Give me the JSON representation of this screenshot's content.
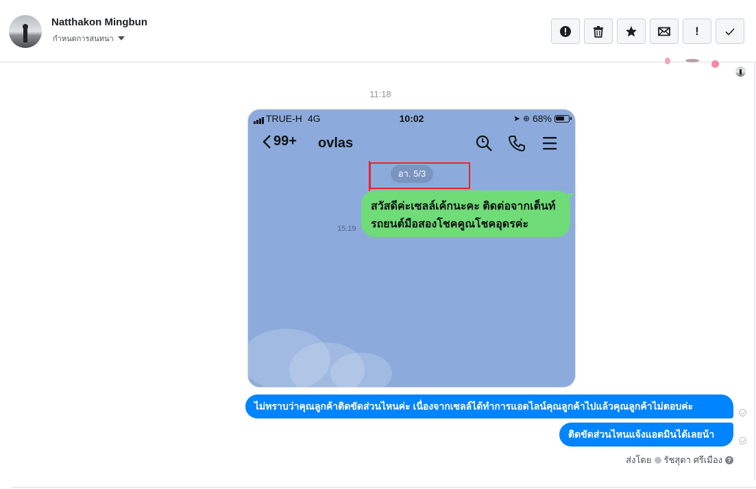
{
  "header": {
    "contact_name": "Natthakon Mingbun",
    "label_dropdown": "กำหนดการสนทนา"
  },
  "toolbar": {
    "buttons": [
      {
        "icon": "alert-circle-icon",
        "name": "mark-spam-button"
      },
      {
        "icon": "trash-icon",
        "name": "delete-button"
      },
      {
        "icon": "star-icon",
        "name": "star-button"
      },
      {
        "icon": "envelope-icon",
        "name": "mark-unread-button"
      },
      {
        "icon": "exclamation-icon",
        "name": "mark-important-button",
        "glyph": "!"
      },
      {
        "icon": "check-icon",
        "name": "mark-done-button"
      }
    ]
  },
  "thread": {
    "timestamp": "11:18",
    "screenshot": {
      "carrier": "TRUE-H",
      "network": "4G",
      "time": "10:02",
      "battery": "68%",
      "back_count": "99+",
      "chat_name": "ovlas",
      "date_pill": "อา. 5/3",
      "bubble_text": "สวัสดีค่ะเซลล์เค้กนะคะ ติดต่อจากเต็นท์รถยนต์มือสองโชคคูณโชคอุดรค่ะ",
      "bubble_time": "15:19"
    },
    "messages": [
      {
        "text": "ไม่ทราบว่าคุณลูกค้าติดขัดส่วนไหนค่ะ เนื่องจากเซลล์ได้ทำการแอดไลน์คุณลูกค้าไปแล้วคุณลูกค้าไม่ตอบค่ะ"
      },
      {
        "text": "ติดขัดส่วนไหนแจ้งแอดมินได้เลยน้า"
      }
    ],
    "sent_by_label": "ส่งโดย",
    "sent_by_name": "รัชสุดา ศรีเมือง"
  },
  "colors": {
    "accent": "#0084ff",
    "line_green": "#6fdc78",
    "line_bg": "#8cabdc",
    "highlight_red": "#e8242a"
  }
}
